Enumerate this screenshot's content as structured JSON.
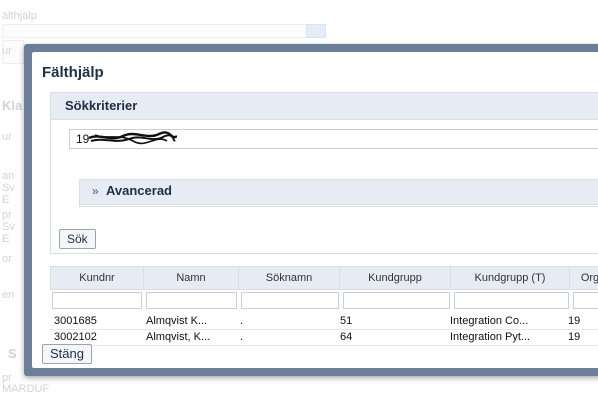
{
  "background": {
    "top_label": "älthjälp",
    "snippets": [
      "ur",
      "Kla",
      "ur",
      "an",
      "Sv",
      "E",
      "pr",
      "Sv",
      "E",
      "or",
      "en",
      "S",
      "pr",
      "MARDUF"
    ]
  },
  "dialog": {
    "title": "Fälthjälp",
    "criteria": {
      "title": "Sökkriterier",
      "search_value": "19"
    },
    "advanced": {
      "icon": "double-chevron-down-icon",
      "label": "Avancerad"
    },
    "search_button": "Sök",
    "close_button": "Stäng",
    "table": {
      "columns": [
        "Kundnr",
        "Namn",
        "Söknamn",
        "Kundgrupp",
        "Kundgrupp (T)",
        "Org"
      ],
      "rows": [
        [
          "3001685",
          "Almqvist K...",
          ".",
          "51",
          "Integration Co...",
          "19"
        ],
        [
          "3002102",
          "Almqvist, K...",
          ".",
          "64",
          "Integration Pyt...",
          "19"
        ]
      ]
    }
  },
  "colors": {
    "dialog_frame": "#6c7f98",
    "header_bg": "#e7ecf4",
    "title_text": "#1f2f44"
  }
}
